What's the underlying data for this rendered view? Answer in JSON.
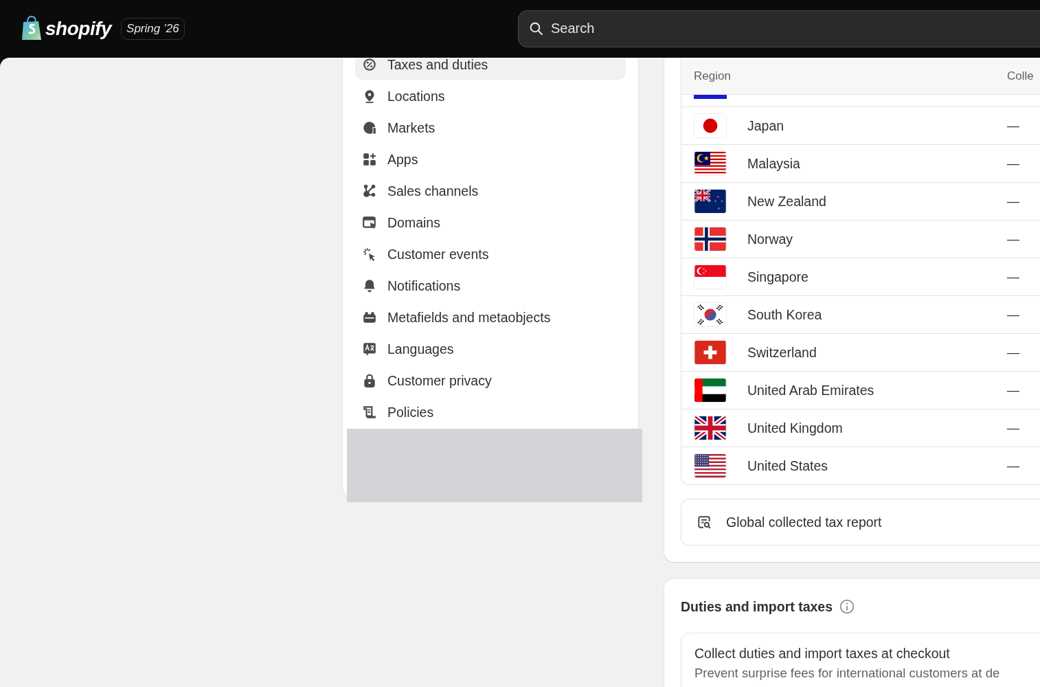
{
  "topbar": {
    "logo_text": "shopify",
    "release_badge": "Spring ’26",
    "search": {
      "placeholder": "Search"
    }
  },
  "settings_nav": {
    "items": [
      {
        "label": "Taxes and duties",
        "selected": true
      },
      {
        "label": "Locations",
        "selected": false
      },
      {
        "label": "Markets",
        "selected": false
      },
      {
        "label": "Apps",
        "selected": false
      },
      {
        "label": "Sales channels",
        "selected": false
      },
      {
        "label": "Domains",
        "selected": false
      },
      {
        "label": "Customer events",
        "selected": false
      },
      {
        "label": "Notifications",
        "selected": false
      },
      {
        "label": "Metafields and metaobjects",
        "selected": false
      },
      {
        "label": "Languages",
        "selected": false
      },
      {
        "label": "Customer privacy",
        "selected": false
      },
      {
        "label": "Policies",
        "selected": false
      }
    ]
  },
  "tax_regions": {
    "columns": [
      "Region",
      "Colle"
    ],
    "rows": [
      {
        "region": "Japan",
        "collected": "—"
      },
      {
        "region": "Malaysia",
        "collected": "—"
      },
      {
        "region": "New Zealand",
        "collected": "—"
      },
      {
        "region": "Norway",
        "collected": "—"
      },
      {
        "region": "Singapore",
        "collected": "—"
      },
      {
        "region": "South Korea",
        "collected": "—"
      },
      {
        "region": "Switzerland",
        "collected": "—"
      },
      {
        "region": "United Arab Emirates",
        "collected": "—"
      },
      {
        "region": "United Kingdom",
        "collected": "—"
      },
      {
        "region": "United States",
        "collected": "—"
      }
    ],
    "report_link": "Global collected tax report"
  },
  "duties": {
    "title": "Duties and import taxes",
    "option": {
      "title": "Collect duties and import taxes at checkout",
      "description": "Prevent surprise fees for international customers at de"
    }
  }
}
